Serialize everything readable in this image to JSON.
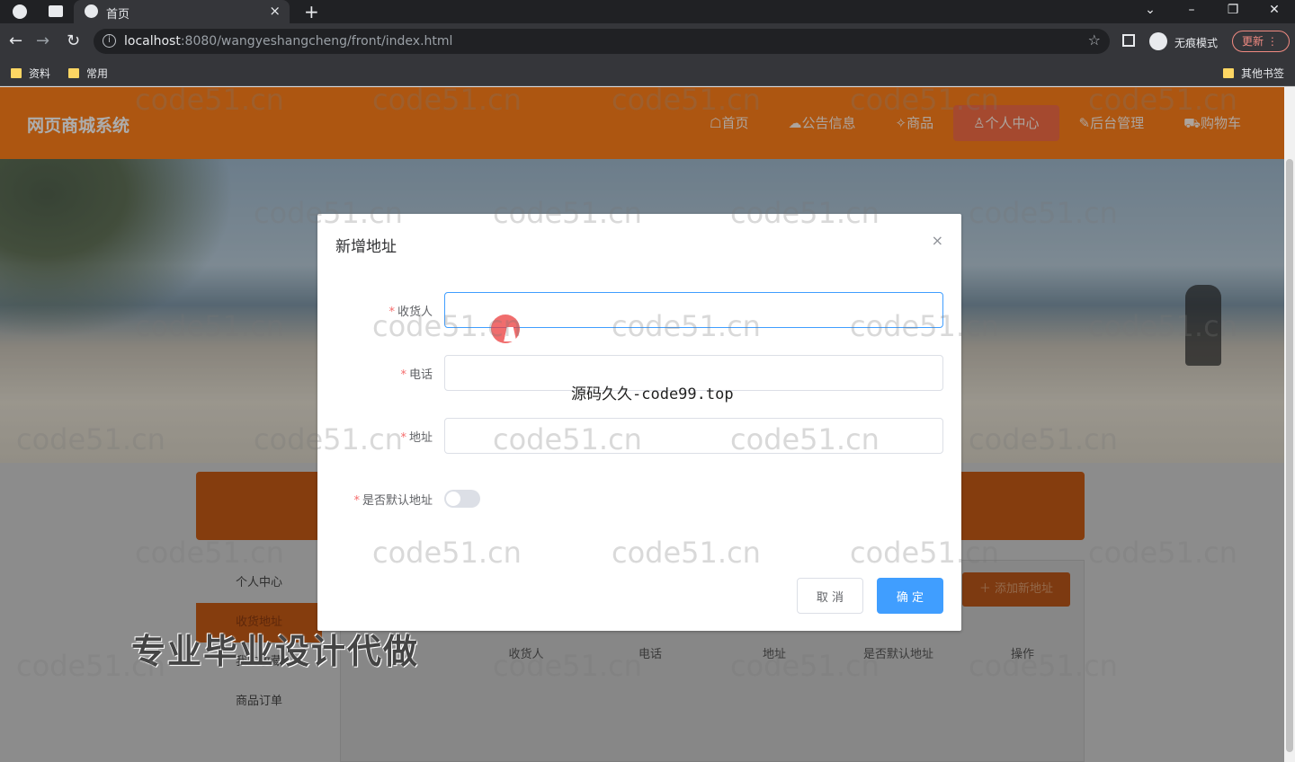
{
  "browser": {
    "tab_title": "首页",
    "url_host": "localhost",
    "url_rest": ":8080/wangyeshangcheng/front/index.html",
    "incognito_label": "无痕模式",
    "update_label": "更新",
    "bookmarks": [
      "资料",
      "常用"
    ],
    "other_bookmarks": "其他书签"
  },
  "site": {
    "brand": "网页商城系统",
    "nav": [
      "☖首页",
      "☁公告信息",
      "✧商品",
      "♙个人中心",
      "✎后台管理",
      "⛟购物车"
    ],
    "sidebar": [
      "个人中心",
      "收货地址",
      "我的收藏",
      "商品订单"
    ],
    "add_button": "＋ 添加新地址",
    "table_headers": [
      "",
      "收货人",
      "电话",
      "地址",
      "是否默认地址",
      "操作"
    ]
  },
  "dialog": {
    "title": "新增地址",
    "close": "×",
    "fields": [
      {
        "label": "收货人",
        "value": ""
      },
      {
        "label": "电话",
        "value": ""
      },
      {
        "label": "地址",
        "value": ""
      }
    ],
    "switch_label": "是否默认地址",
    "cancel": "取 消",
    "ok": "确 定"
  },
  "overlays": {
    "mid_text": "源码久久-code99.top",
    "ad_text": "专业毕业设计代做",
    "watermark": "code51.cn"
  },
  "colors": {
    "header": "#ff7f1a",
    "primary": "#409eff",
    "required": "#f56c6c"
  }
}
